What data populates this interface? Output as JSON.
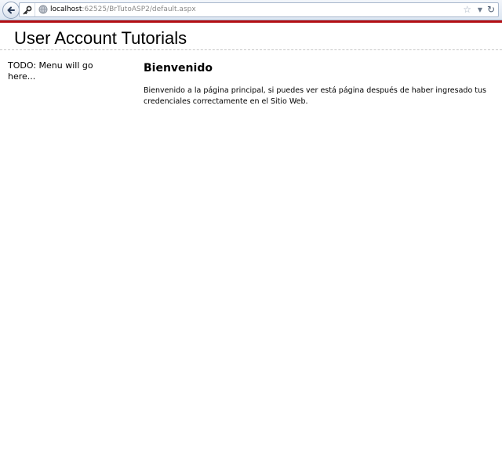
{
  "browser": {
    "url_host": "localhost",
    "url_rest": ":62525/BrTutoASP2/default.aspx"
  },
  "header": {
    "title": "User Account Tutorials"
  },
  "sidebar": {
    "todo_text": "TODO: Menu will go here..."
  },
  "main": {
    "heading": "Bienvenido",
    "body": "Bienvenido a la página principal, si puedes ver está página después de haber ingresado tus credenciales correctamente en el Sitio Web."
  },
  "icons": {
    "back": "back-arrow-icon",
    "site_info": "key-icon",
    "page": "globe-icon",
    "bookmark": "star-icon",
    "dropdown": "dropdown-icon",
    "reload": "reload-icon"
  },
  "colors": {
    "accent_rule": "#b40f14"
  }
}
